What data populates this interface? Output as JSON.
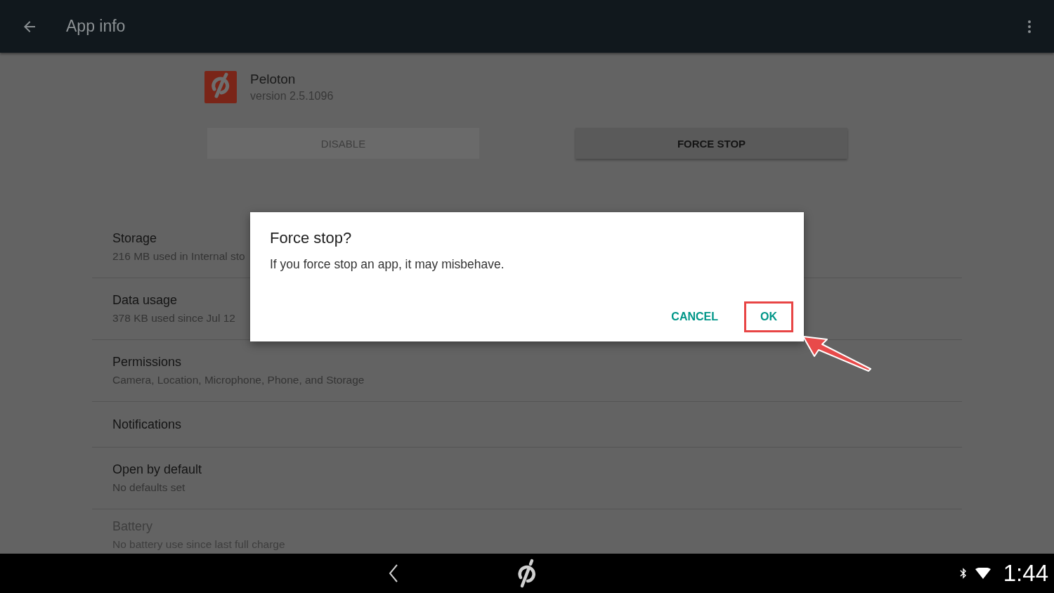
{
  "app_bar": {
    "title": "App info"
  },
  "app": {
    "name": "Peloton",
    "version": "version 2.5.1096"
  },
  "buttons": [
    {
      "label": "DISABLE",
      "disabled": true
    },
    {
      "label": "FORCE STOP",
      "disabled": false
    }
  ],
  "settings": [
    {
      "title": "Storage",
      "subtitle": "216 MB used in Internal sto",
      "disabled": false
    },
    {
      "title": "Data usage",
      "subtitle": "378 KB used since Jul 12",
      "disabled": false
    },
    {
      "title": "Permissions",
      "subtitle": "Camera, Location, Microphone, Phone, and Storage",
      "disabled": false
    },
    {
      "title": "Notifications",
      "disabled": false
    },
    {
      "title": "Open by default",
      "subtitle": "No defaults set",
      "disabled": false
    },
    {
      "title": "Battery",
      "subtitle": "No battery use since last full charge",
      "disabled": true
    }
  ],
  "dialog": {
    "title": "Force stop?",
    "message": "If you force stop an app, it may misbehave.",
    "actions": [
      {
        "label": "CANCEL",
        "highlighted": false
      },
      {
        "label": "OK",
        "highlighted": true
      }
    ]
  },
  "status": {
    "time": "1:44"
  }
}
